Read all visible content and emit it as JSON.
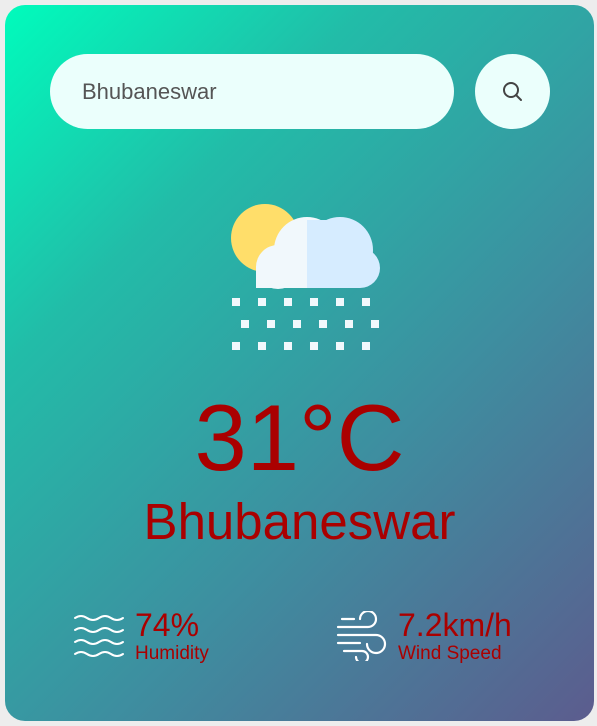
{
  "search": {
    "value": "Bhubaneswar"
  },
  "weather": {
    "icon": "partly-cloudy-snow-icon",
    "temperature": "31°C",
    "city": "Bhubaneswar"
  },
  "details": {
    "humidity": {
      "value": "74%",
      "label": "Humidity",
      "icon": "humidity-waves-icon"
    },
    "wind": {
      "value": "7.2km/h",
      "label": "Wind Speed",
      "icon": "wind-icon"
    }
  },
  "colors": {
    "accent": "#aa0000",
    "field_bg": "#ebfffc",
    "gradient_start": "#00fcbc",
    "gradient_end": "#5c5c8e"
  }
}
